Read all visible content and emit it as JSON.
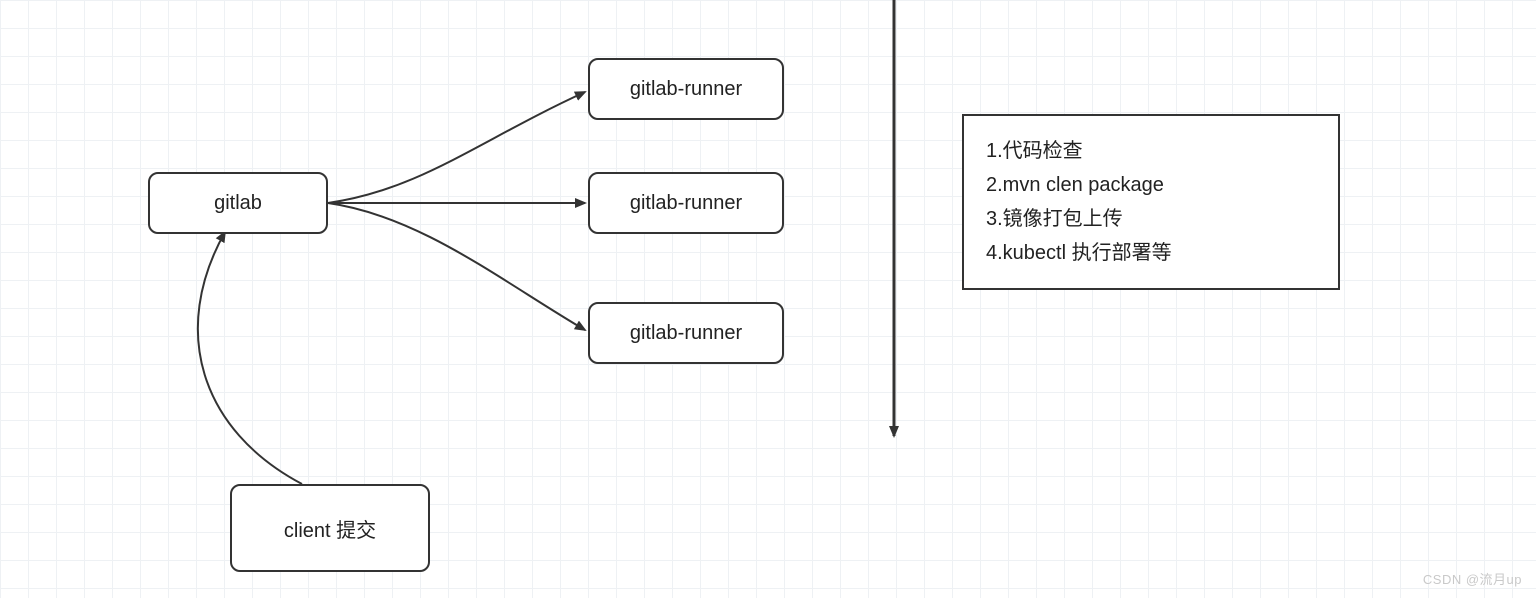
{
  "nodes": {
    "gitlab": {
      "label": "gitlab"
    },
    "runner1": {
      "label": "gitlab-runner"
    },
    "runner2": {
      "label": "gitlab-runner"
    },
    "runner3": {
      "label": "gitlab-runner"
    },
    "client": {
      "label": "client 提交"
    }
  },
  "steps": {
    "line1": "1.代码检查",
    "line2": "2.mvn clen package",
    "line3": "3.镜像打包上传",
    "line4": "4.kubectl 执行部署等"
  },
  "watermark": "CSDN @流月up"
}
